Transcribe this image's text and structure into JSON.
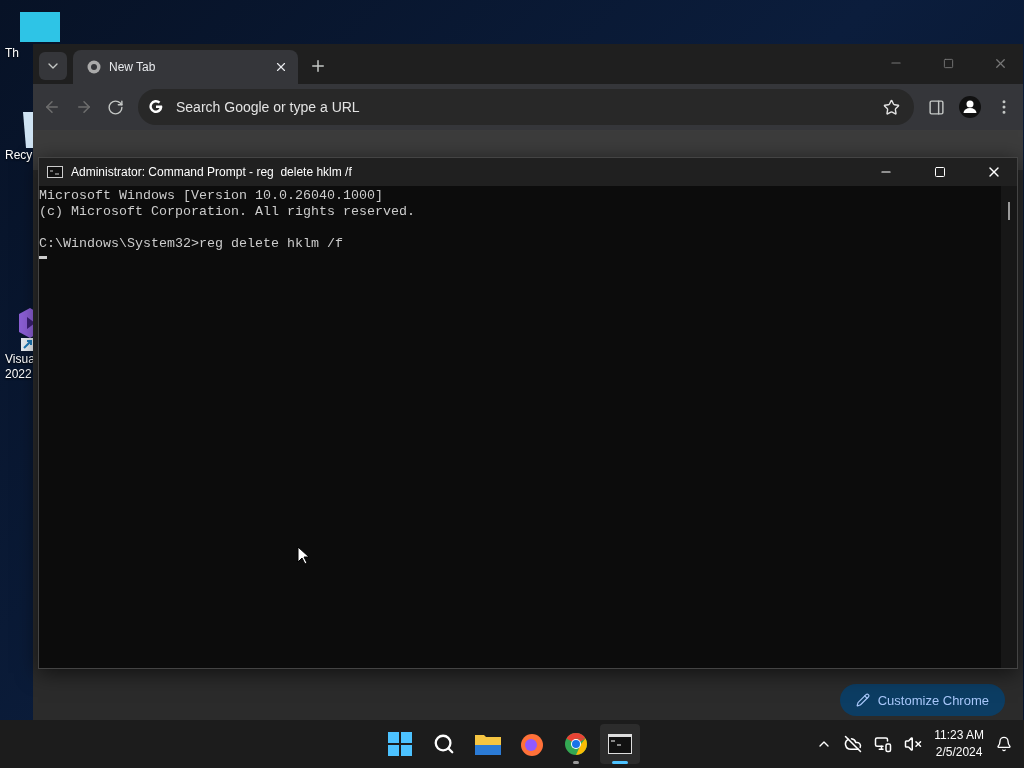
{
  "desktop_icons": [
    {
      "kind": "monitor",
      "lines": [
        "Th"
      ]
    },
    {
      "kind": "bin",
      "lines": [
        "Recy"
      ]
    },
    {
      "kind": "studio",
      "lines": [
        "Visua",
        "2022"
      ]
    }
  ],
  "browser": {
    "tabs": [
      {
        "label": "New Tab",
        "selected": true
      }
    ],
    "omnibox": {
      "placeholder": "Search Google or type a URL"
    },
    "customize_button": "Customize Chrome"
  },
  "console": {
    "title": "Administrator: Command Prompt - reg  delete hklm /f",
    "blocks": [
      [
        "Microsoft Windows [Version 10.0.26040.1000]",
        "(c) Microsoft Corporation. All rights reserved."
      ],
      [
        "C:\\Windows\\System32>reg delete hklm /f"
      ]
    ],
    "cursor": true
  },
  "taskbar": {
    "apps": [
      {
        "kind": "start",
        "running": false,
        "active": false
      },
      {
        "kind": "search",
        "running": false,
        "active": false
      },
      {
        "kind": "files",
        "running": false,
        "active": false
      },
      {
        "kind": "firefox",
        "running": false,
        "active": false
      },
      {
        "kind": "chrome",
        "running": true,
        "active": false
      },
      {
        "kind": "terminal",
        "running": true,
        "active": true
      }
    ],
    "time": "11:23 AM",
    "date": "2/5/2024"
  }
}
